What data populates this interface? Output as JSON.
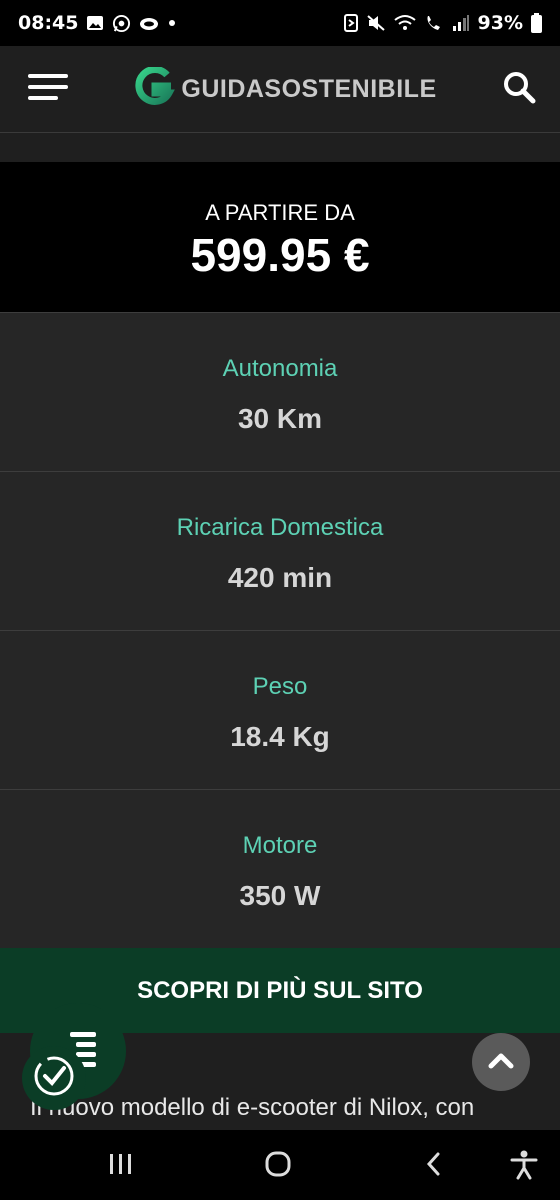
{
  "status_bar": {
    "time": "08:45",
    "battery": "93%",
    "left_icons": [
      "image-icon",
      "whatsapp-icon",
      "cloud-icon",
      "dot-icon"
    ],
    "right_icons": [
      "nfc-icon",
      "mute-icon",
      "wifi-icon",
      "wifi-call-icon",
      "signal-icon",
      "battery-icon"
    ]
  },
  "header": {
    "logo_text": "GUIDASOSTENIBILE",
    "menu_icon": "hamburger-menu-icon",
    "search_icon": "search-icon"
  },
  "price": {
    "label": "A PARTIRE DA",
    "value": "599.95 €"
  },
  "specs": [
    {
      "label": "Autonomia",
      "value": "30 Km"
    },
    {
      "label": "Ricarica Domestica",
      "value": "420 min"
    },
    {
      "label": "Peso",
      "value": "18.4 Kg"
    },
    {
      "label": "Motore",
      "value": "350 W"
    }
  ],
  "cta": {
    "label": "SCOPRI DI PIÙ SUL SITO"
  },
  "article": {
    "text": "Il nuovo modello di e-scooter di Nilox, con"
  },
  "floating": {
    "toc_icon": "list-icon",
    "check_icon": "clock-check-icon",
    "top_icon": "chevron-up-icon"
  },
  "navbar": {
    "icons": [
      "recent-apps-icon",
      "home-icon",
      "back-icon",
      "accessibility-icon"
    ]
  },
  "colors": {
    "accent": "#5dd1b4",
    "cta_bg": "#0b3d26",
    "page_bg": "#1f1f1f"
  }
}
